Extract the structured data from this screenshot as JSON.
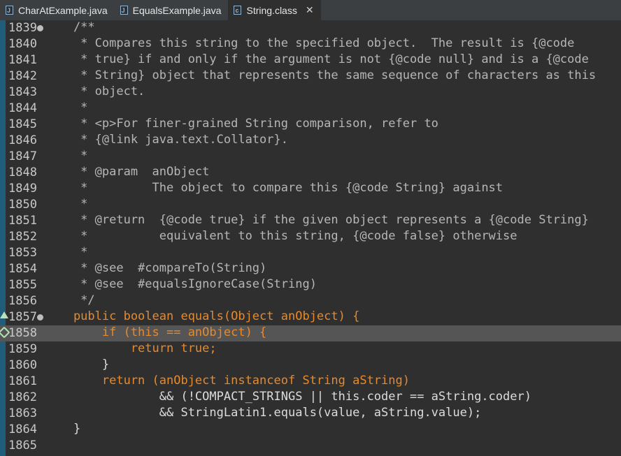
{
  "tabs": [
    {
      "label": "CharAtExample.java",
      "active": false
    },
    {
      "label": "EqualsExample.java",
      "active": false
    },
    {
      "label": "String.class",
      "active": true
    }
  ],
  "editor": {
    "lines": [
      {
        "num": "1839",
        "text": "    /**"
      },
      {
        "num": "1840",
        "text": "     * Compares this string to the specified object.  The result is {@code"
      },
      {
        "num": "1841",
        "text": "     * true} if and only if the argument is not {@code null} and is a {@code"
      },
      {
        "num": "1842",
        "text": "     * String} object that represents the same sequence of characters as this"
      },
      {
        "num": "1843",
        "text": "     * object."
      },
      {
        "num": "1844",
        "text": "     *"
      },
      {
        "num": "1845",
        "text": "     * <p>For finer-grained String comparison, refer to"
      },
      {
        "num": "1846",
        "text": "     * {@link java.text.Collator}."
      },
      {
        "num": "1847",
        "text": "     *"
      },
      {
        "num": "1848",
        "text": "     * @param  anObject"
      },
      {
        "num": "1849",
        "text": "     *         The object to compare this {@code String} against"
      },
      {
        "num": "1850",
        "text": "     *"
      },
      {
        "num": "1851",
        "text": "     * @return  {@code true} if the given object represents a {@code String}"
      },
      {
        "num": "1852",
        "text": "     *          equivalent to this string, {@code false} otherwise"
      },
      {
        "num": "1853",
        "text": "     *"
      },
      {
        "num": "1854",
        "text": "     * @see  #compareTo(String)"
      },
      {
        "num": "1855",
        "text": "     * @see  #equalsIgnoreCase(String)"
      },
      {
        "num": "1856",
        "text": "     */"
      },
      {
        "num": "1857",
        "text": "    public boolean equals(Object anObject) {"
      },
      {
        "num": "1858",
        "text": "        if (this == anObject) {"
      },
      {
        "num": "1859",
        "text": "            return true;"
      },
      {
        "num": "1860",
        "text": "        }"
      },
      {
        "num": "1861",
        "text": "        return (anObject instanceof String aString)"
      },
      {
        "num": "1862",
        "text": "                && (!COMPACT_STRINGS || this.coder == aString.coder)"
      },
      {
        "num": "1863",
        "text": "                && StringLatin1.equals(value, aString.value);"
      },
      {
        "num": "1864",
        "text": "    }"
      },
      {
        "num": "1865",
        "text": ""
      }
    ]
  }
}
